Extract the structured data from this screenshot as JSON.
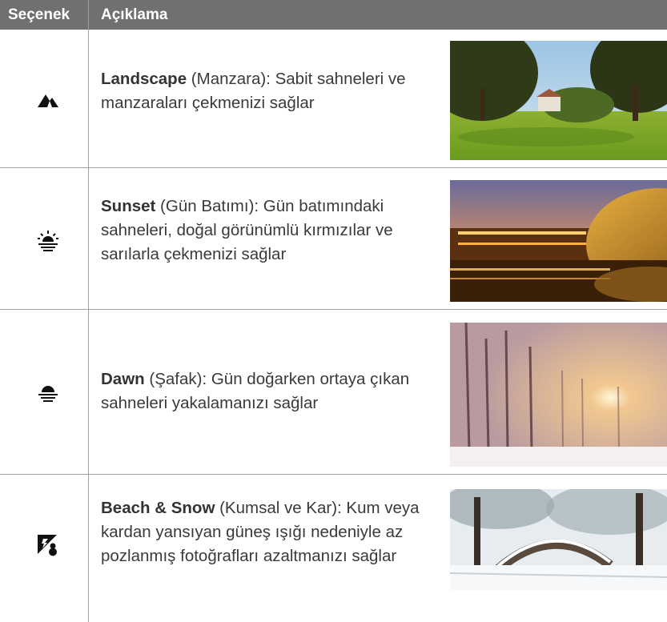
{
  "header": {
    "option_label": "Seçenek",
    "description_label": "Açıklama"
  },
  "rows": [
    {
      "icon": "landscape-icon",
      "title": "Landscape",
      "desc": " (Manzara): Sabit sahneleri ve manzaraları çekmenizi sağlar",
      "photo": "park-landscape-photo"
    },
    {
      "icon": "sunset-icon",
      "title": "Sunset",
      "desc": " (Gün Batımı): Gün batımındaki sahneleri, doğal görünümlü kırmızılar ve sarılarla çekmenizi sağlar",
      "photo": "sunset-city-photo"
    },
    {
      "icon": "dawn-icon",
      "title": "Dawn",
      "desc": " (Şafak): Gün doğarken ortaya çıkan sahneleri yakalamanızı sağlar",
      "photo": "foggy-dawn-photo"
    },
    {
      "icon": "beach-snow-icon",
      "title": "Beach & Snow",
      "desc": " (Kumsal ve Kar): Kum veya kardan yansıyan güneş ışığı nedeniyle az pozlanmış fotoğrafları azaltmanızı sağlar",
      "photo": "snow-park-photo"
    }
  ],
  "colors": {
    "header_bg": "#707070",
    "header_text": "#ffffff",
    "body_text": "#3a3a3a",
    "rule": "#a0a0a0"
  }
}
